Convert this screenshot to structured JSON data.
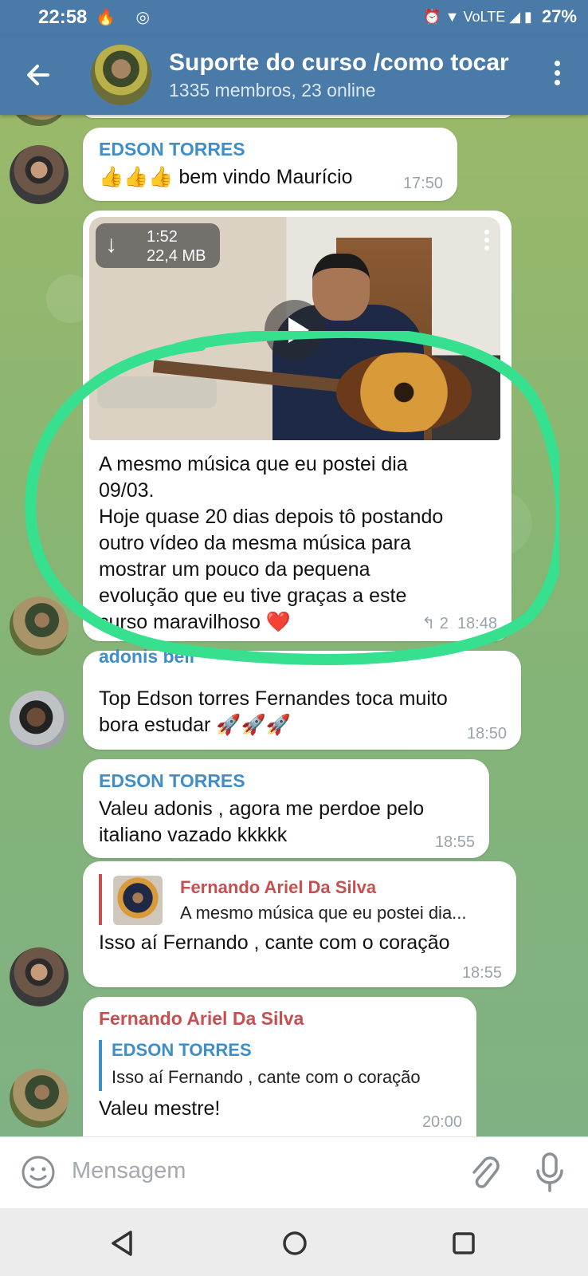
{
  "status": {
    "time": "22:58",
    "battery": "27%",
    "left_icons": "🔥 ◎",
    "right_icons": "⏰ ▼ VoLTE ◢ ▮"
  },
  "header": {
    "title": "Suporte do curso /como tocar",
    "subtitle": "1335 membros, 23 online"
  },
  "messages": [
    {
      "sender": "EDSON TORRES",
      "text": "👍👍👍 bem vindo Maurício",
      "time": "17:50"
    },
    {
      "video_duration": "1:52",
      "video_size": "22,4 MB",
      "text_lines": [
        "A mesmo música que eu postei dia",
        "09/03.",
        "Hoje quase 20 dias depois tô postando",
        "outro vídeo da mesma música para",
        "mostrar um pouco da pequena",
        "evolução que eu tive graças a este",
        "curso maravilhoso ❤️"
      ],
      "replies": "↰ 2",
      "time": "18:48"
    },
    {
      "sender_partial": "adonis bell",
      "text_lines": [
        "Top Edson torres Fernandes toca muito",
        "bora estudar 🚀🚀🚀"
      ],
      "time": "18:50"
    },
    {
      "sender": "EDSON TORRES",
      "text_lines": [
        "Valeu adonis , agora me perdoe pelo",
        "italiano vazado kkkkk"
      ],
      "time": "18:55"
    },
    {
      "quote_sender": "Fernando Ariel Da Silva",
      "quote_text": "A mesmo música que eu postei dia...",
      "text": "Isso aí Fernando , cante com o coração",
      "time": "18:55"
    },
    {
      "sender": "Fernando Ariel Da Silva",
      "quote_sender": "EDSON TORRES",
      "quote_text": "Isso aí Fernando , cante com o coração",
      "text": "Valeu mestre!",
      "time": "20:00"
    }
  ],
  "input": {
    "placeholder": "Mensagem"
  },
  "colors": {
    "header": "#4a7aa8",
    "sender_blue": "#3f8ec7",
    "sender_red": "#c64f4f",
    "highlight": "#36e08f"
  }
}
